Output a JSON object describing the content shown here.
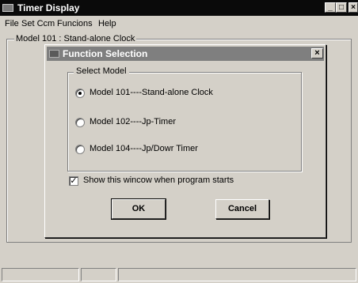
{
  "window": {
    "title": "Timer Display",
    "controls": {
      "minimize": "_",
      "maximize": "□",
      "close": "×"
    }
  },
  "menu": {
    "file": "File",
    "set_com": "Set Ccm",
    "functions": "Funcions",
    "help": "Help"
  },
  "main": {
    "frame_label": "Model 101 : Stand-alone Clock"
  },
  "dialog": {
    "title": "Function Selection",
    "close": "×",
    "group_label": "Select Model",
    "options": [
      {
        "label": "Model 101----Stand-alone Clock",
        "checked": true
      },
      {
        "label": "Model 102----Jp-Timer",
        "checked": false
      },
      {
        "label": "Model 104----Jp/Dowr Timer",
        "checked": false
      }
    ],
    "checkbox": {
      "label": "Show this wincow when program starts",
      "checked": true,
      "mark": "✓"
    },
    "ok_label": "OK",
    "cancel_label": "Cancel"
  },
  "status": {
    "panes": [
      "",
      "",
      ""
    ]
  },
  "colors": {
    "face": "#d4d0c8",
    "title_active": "#0a0a0a",
    "title_inactive": "#7f7f7f"
  },
  "icons": [
    "app-icon",
    "dialog-icon",
    "close-icon",
    "minimize-icon",
    "maximize-icon"
  ]
}
